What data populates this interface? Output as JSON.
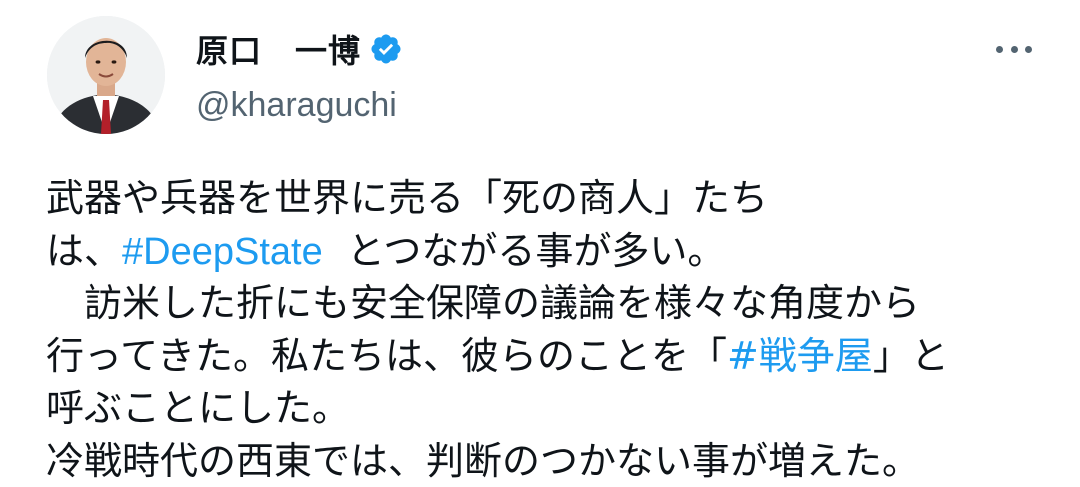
{
  "author": {
    "display_name": "原口　一博",
    "handle": "@kharaguchi",
    "verified": true,
    "avatar_icon": "profile-photo"
  },
  "menu": {
    "icon": "more-options-icon"
  },
  "tweet": {
    "line1": "武器や兵器を世界に売る「死の商人」たち",
    "line2_prefix": "は、",
    "line2_tag": "#DeepState",
    "line2_suffix": "  とつながる事が多い。",
    "line3": "　訪米した折にも安全保障の議論を様々な角度から",
    "line4_prefix": "行ってきた。私たちは、彼らのことを「",
    "line4_tag": "#戦争屋",
    "line4_suffix": "」と",
    "line5": "呼ぶことにした。",
    "line6": "冷戦時代の西東では、判断のつかない事が増えた。"
  },
  "colors": {
    "link": "#1d9bf0",
    "text": "#0f1419",
    "secondary": "#536471",
    "verified": "#1d9bf0"
  }
}
